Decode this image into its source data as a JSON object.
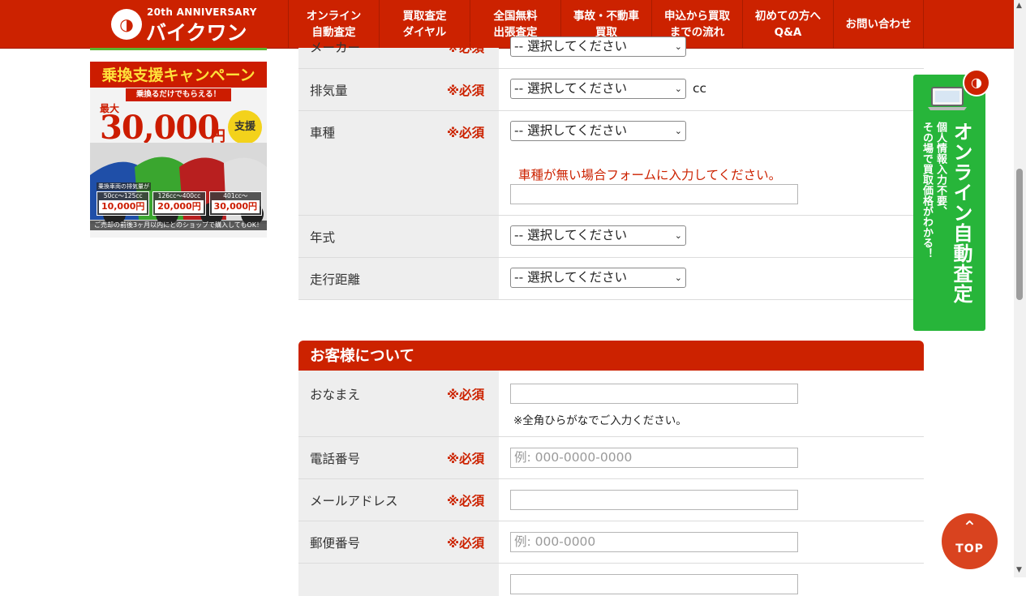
{
  "header": {
    "logo": {
      "anniversary": "20th ANNIVERSARY",
      "name": "バイクワン"
    },
    "nav": [
      {
        "label": "オンライン\n自動査定",
        "width": 112
      },
      {
        "label": "買取査定\nダイヤル",
        "width": 112
      },
      {
        "label": "全国無料\n出張査定",
        "width": 112
      },
      {
        "label": "事故・不動車\n買取",
        "width": 112
      },
      {
        "label": "申込から買取\nまでの流れ",
        "width": 112
      },
      {
        "label": "初めての方へ\nQ&A",
        "width": 112
      },
      {
        "label": "お問い合わせ",
        "width": 112
      }
    ]
  },
  "sidebar": {
    "banner": {
      "title": "乗換支援キャンペーン",
      "subtitle": "乗換るだけでもらえる！",
      "max_label": "最大",
      "amount": "30,000",
      "yen": "円",
      "badge": "支援",
      "caption": "乗換車両の排気量が",
      "tiers": [
        {
          "range": "50cc～125cc",
          "amount": "10,000円"
        },
        {
          "range": "126cc～400cc",
          "amount": "20,000円"
        },
        {
          "range": "401cc～",
          "amount": "30,000円"
        }
      ],
      "footer": "ご売却の前後3ヶ月以内にとのショップで購入してもOK！"
    }
  },
  "vehicle_form": {
    "rows": [
      {
        "label": "メーカー",
        "required": "※必須",
        "select": "-- 選択してください"
      },
      {
        "label": "排気量",
        "required": "※必須",
        "select": "-- 選択してください",
        "unit": "cc"
      },
      {
        "label": "車種",
        "required": "※必須",
        "select": "-- 選択してください",
        "note": "車種が無い場合フォームに入力してください。",
        "input_value": ""
      },
      {
        "label": "年式",
        "required": "",
        "select": "-- 選択してください"
      },
      {
        "label": "走行距離",
        "required": "",
        "select": "-- 選択してください"
      }
    ]
  },
  "customer_section": {
    "title": "お客様について",
    "rows": [
      {
        "label": "おなまえ",
        "required": "※必須",
        "placeholder": "",
        "note": "※全角ひらがなでご入力ください。"
      },
      {
        "label": "電話番号",
        "required": "※必須",
        "placeholder": "例: 000-0000-0000"
      },
      {
        "label": "メールアドレス",
        "required": "※必須",
        "placeholder": ""
      },
      {
        "label": "郵便番号",
        "required": "※必須",
        "placeholder": "例: 000-0000"
      }
    ]
  },
  "float_panel": {
    "title": "オンライン自動査定",
    "subtitle": "個人情報入力不要、\nその場で買取価格がわかる！",
    "color": "#27b53a"
  },
  "top_button": {
    "label": "TOP",
    "arrow": "⌃"
  },
  "colors": {
    "brand": "#cc2200",
    "required": "#cc2200",
    "label_bg": "#eeeeee",
    "panel": "#27b53a"
  }
}
